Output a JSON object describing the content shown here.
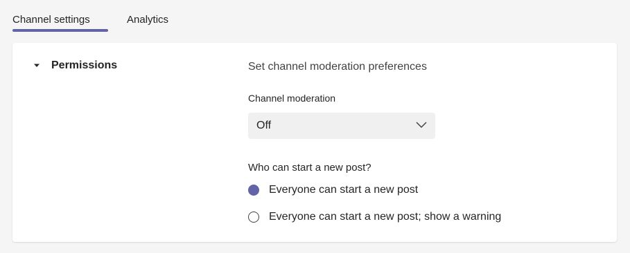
{
  "tabs": [
    {
      "label": "Channel settings",
      "active": true
    },
    {
      "label": "Analytics",
      "active": false
    }
  ],
  "permissions": {
    "title": "Permissions",
    "description": "Set channel moderation preferences",
    "moderation": {
      "label": "Channel moderation",
      "value": "Off"
    },
    "who_can_post": {
      "question": "Who can start a new post?",
      "options": [
        {
          "label": "Everyone can start a new post",
          "selected": true
        },
        {
          "label": "Everyone can start a new post; show a warning",
          "selected": false
        }
      ]
    }
  },
  "colors": {
    "accent": "#6264a7",
    "background": "#f5f5f5",
    "panel": "#ffffff"
  }
}
